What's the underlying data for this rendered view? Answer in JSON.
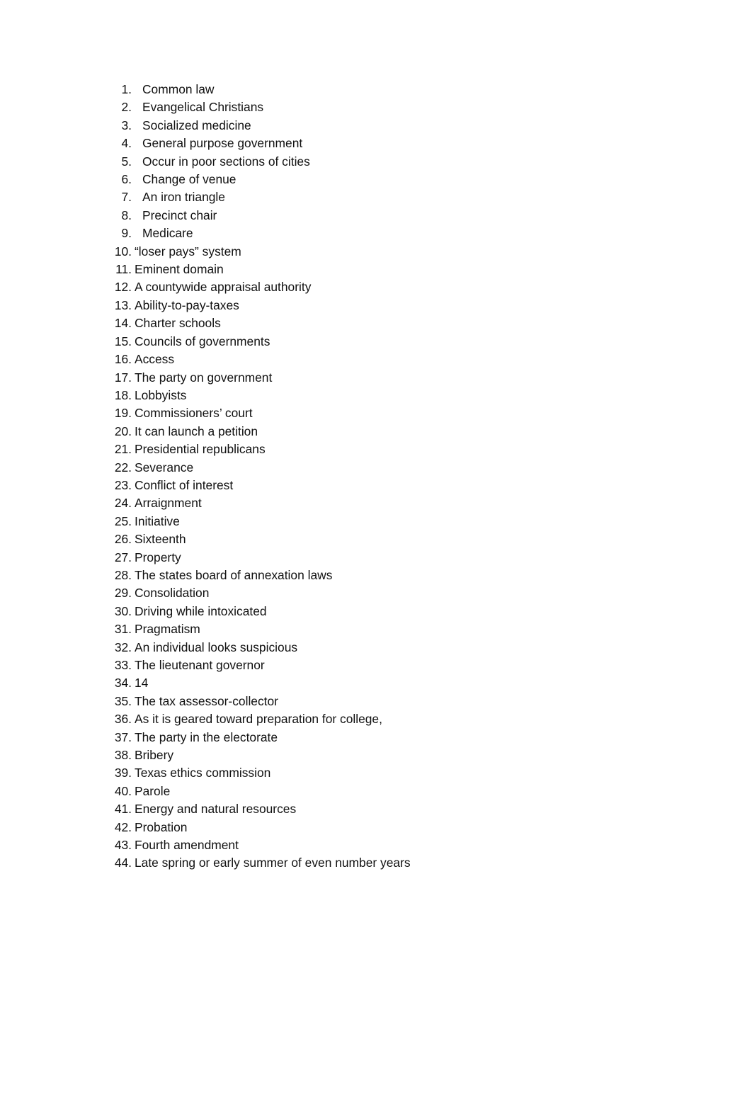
{
  "document": {
    "type": "answer-key-list",
    "background_color": "#ffffff",
    "text_color": "#111111",
    "items": [
      {
        "number": "1.",
        "text": "Common law"
      },
      {
        "number": "2.",
        "text": "Evangelical Christians"
      },
      {
        "number": "3.",
        "text": "Socialized medicine"
      },
      {
        "number": "4.",
        "text": "General purpose government"
      },
      {
        "number": "5.",
        "text": "Occur in poor sections of cities"
      },
      {
        "number": "6.",
        "text": "Change of venue"
      },
      {
        "number": "7.",
        "text": "An iron triangle"
      },
      {
        "number": "8.",
        "text": "Precinct chair"
      },
      {
        "number": "9.",
        "text": "Medicare"
      },
      {
        "number": "10.",
        "text": "“loser pays” system"
      },
      {
        "number": "11.",
        "text": "Eminent domain"
      },
      {
        "number": "12.",
        "text": "A countywide appraisal authority"
      },
      {
        "number": "13.",
        "text": "Ability-to-pay-taxes"
      },
      {
        "number": "14.",
        "text": "Charter schools"
      },
      {
        "number": "15.",
        "text": "Councils of governments"
      },
      {
        "number": "16.",
        "text": "Access"
      },
      {
        "number": "17.",
        "text": "The party on government"
      },
      {
        "number": "18.",
        "text": "Lobbyists"
      },
      {
        "number": "19.",
        "text": "Commissioners’ court"
      },
      {
        "number": "20.",
        "text": "It can launch a petition"
      },
      {
        "number": "21.",
        "text": "Presidential republicans"
      },
      {
        "number": "22.",
        "text": "Severance"
      },
      {
        "number": "23.",
        "text": "Conflict of interest"
      },
      {
        "number": "24.",
        "text": "Arraignment"
      },
      {
        "number": "25.",
        "text": "Initiative"
      },
      {
        "number": "26.",
        "text": "Sixteenth"
      },
      {
        "number": "27.",
        "text": "Property"
      },
      {
        "number": "28.",
        "text": "The states board of annexation laws"
      },
      {
        "number": "29.",
        "text": "Consolidation"
      },
      {
        "number": "30.",
        "text": "Driving while intoxicated"
      },
      {
        "number": "31.",
        "text": "Pragmatism"
      },
      {
        "number": "32.",
        "text": "An individual looks suspicious"
      },
      {
        "number": "33.",
        "text": "The lieutenant governor"
      },
      {
        "number": "34.",
        "text": "14"
      },
      {
        "number": "35.",
        "text": "The tax assessor-collector"
      },
      {
        "number": "36.",
        "text": "As it is geared toward preparation for college,"
      },
      {
        "number": "37.",
        "text": "The party in the electorate"
      },
      {
        "number": "38.",
        "text": "Bribery"
      },
      {
        "number": "39.",
        "text": "Texas ethics commission"
      },
      {
        "number": "40.",
        "text": "Parole"
      },
      {
        "number": "41.",
        "text": "Energy and natural resources"
      },
      {
        "number": "42.",
        "text": "Probation"
      },
      {
        "number": "43.",
        "text": "Fourth amendment"
      },
      {
        "number": "44.",
        "text": "Late spring or early summer of even number years"
      }
    ]
  }
}
